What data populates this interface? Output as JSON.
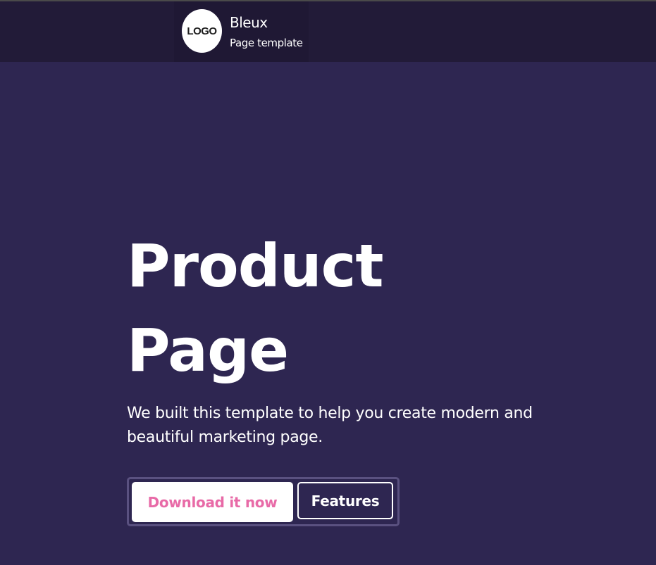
{
  "header": {
    "logo_text": "LOGO",
    "brand_name": "Bleux",
    "brand_subtitle": "Page template"
  },
  "hero": {
    "title_line1": "Product",
    "title_line2": "Page",
    "description": "We built this template to help you create modern and beautiful marketing page.",
    "primary_button": "Download it now",
    "secondary_button": "Features"
  },
  "colors": {
    "background": "#2e2651",
    "header_background": "#221b38",
    "accent_pink": "#e86aa7",
    "text": "#ffffff"
  }
}
